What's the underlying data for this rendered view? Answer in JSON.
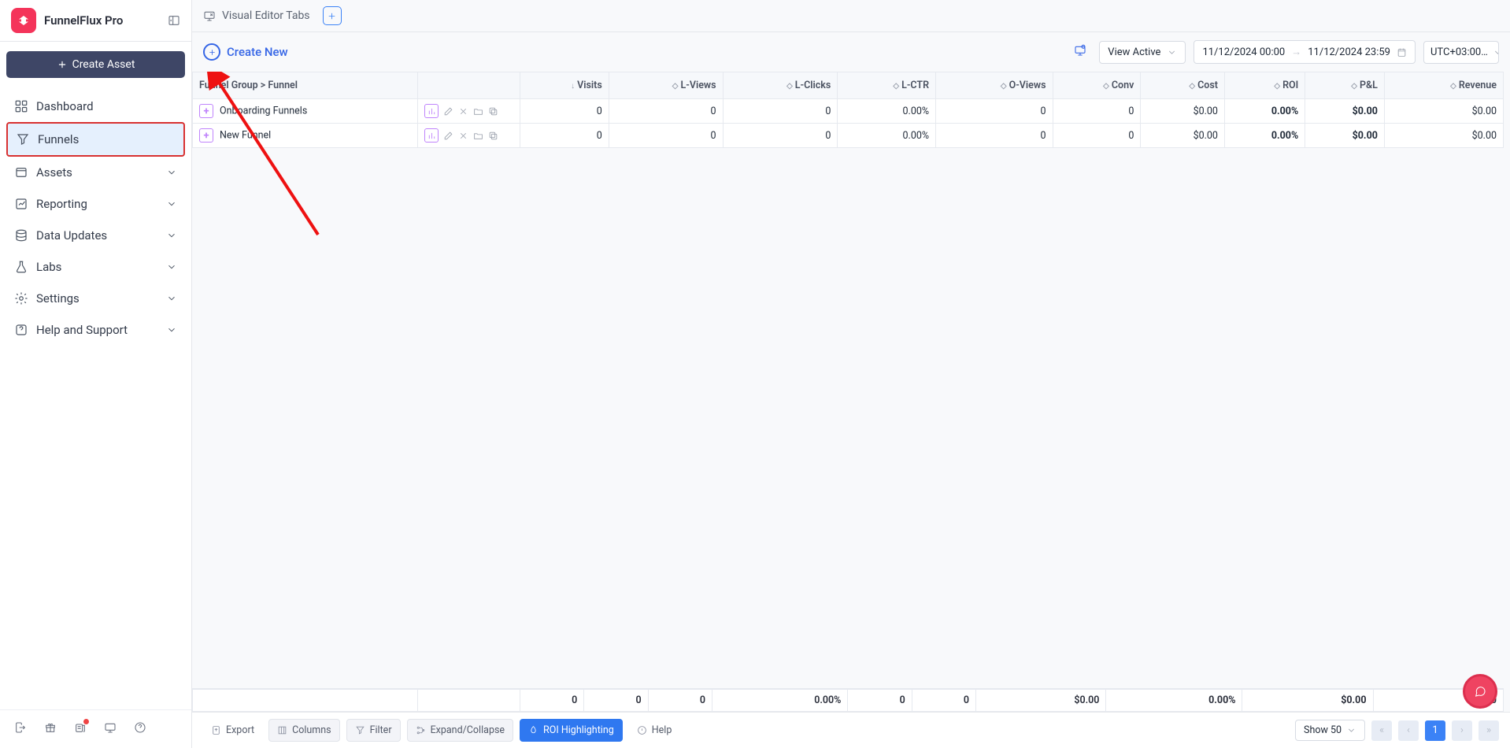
{
  "app": {
    "title": "FunnelFlux Pro"
  },
  "sidebar": {
    "create_label": "Create Asset",
    "items": [
      {
        "label": "Dashboard"
      },
      {
        "label": "Funnels"
      },
      {
        "label": "Assets"
      },
      {
        "label": "Reporting"
      },
      {
        "label": "Data Updates"
      },
      {
        "label": "Labs"
      },
      {
        "label": "Settings"
      },
      {
        "label": "Help and Support"
      }
    ]
  },
  "topbar": {
    "visual_editor_label": "Visual Editor Tabs"
  },
  "toolbar": {
    "create_new": "Create New",
    "view_active": "View Active",
    "date_start": "11/12/2024 00:00",
    "date_end": "11/12/2024 23:59",
    "tz": "UTC+03:00…"
  },
  "table": {
    "headers": {
      "group": "Funnel Group > Funnel",
      "visits": "Visits",
      "lviews": "L-Views",
      "lclicks": "L-Clicks",
      "lctr": "L-CTR",
      "oviews": "O-Views",
      "conv": "Conv",
      "cost": "Cost",
      "roi": "ROI",
      "pl": "P&L",
      "revenue": "Revenue"
    },
    "rows": [
      {
        "name": "Onboarding Funnels",
        "visits": "0",
        "lviews": "0",
        "lclicks": "0",
        "lctr": "0.00%",
        "oviews": "0",
        "conv": "0",
        "cost": "$0.00",
        "roi": "0.00%",
        "pl": "$0.00",
        "revenue": "$0.00"
      },
      {
        "name": "New Funnel",
        "visits": "0",
        "lviews": "0",
        "lclicks": "0",
        "lctr": "0.00%",
        "oviews": "0",
        "conv": "0",
        "cost": "$0.00",
        "roi": "0.00%",
        "pl": "$0.00",
        "revenue": "$0.00"
      }
    ],
    "totals": {
      "visits": "0",
      "lviews": "0",
      "lclicks": "0",
      "lctr": "0.00%",
      "oviews": "0",
      "conv": "0",
      "cost": "$0.00",
      "roi": "0.00%",
      "pl": "$0.00",
      "revenue": "$0.00"
    }
  },
  "footer": {
    "export": "Export",
    "columns": "Columns",
    "filter": "Filter",
    "expand": "Expand/Collapse",
    "roi": "ROI Highlighting",
    "help": "Help",
    "show": "Show 50",
    "page": "1"
  }
}
